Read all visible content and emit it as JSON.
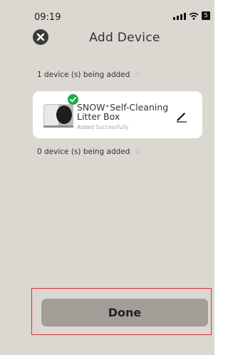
{
  "status_bar": {
    "time": "09:19",
    "battery": "5"
  },
  "header": {
    "title": "Add Device"
  },
  "sections": {
    "adding_label": "1 device (s) being added",
    "pending_label": "0 device (s) being added"
  },
  "device": {
    "name": "SNOW⁺Self-Cleaning Litter Box",
    "status": "Added Successfully"
  },
  "footer": {
    "done_label": "Done"
  },
  "colors": {
    "background": "#dbd7d1",
    "card": "#ffffff",
    "success": "#1fa94c",
    "done_button": "#a39d97",
    "highlight": "#d9303a"
  },
  "icons": {
    "close": "close-icon",
    "spinner": "spinner-icon",
    "success": "check-icon",
    "edit": "pencil-icon",
    "signal": "signal-icon",
    "wifi": "wifi-icon",
    "battery": "battery-icon"
  }
}
